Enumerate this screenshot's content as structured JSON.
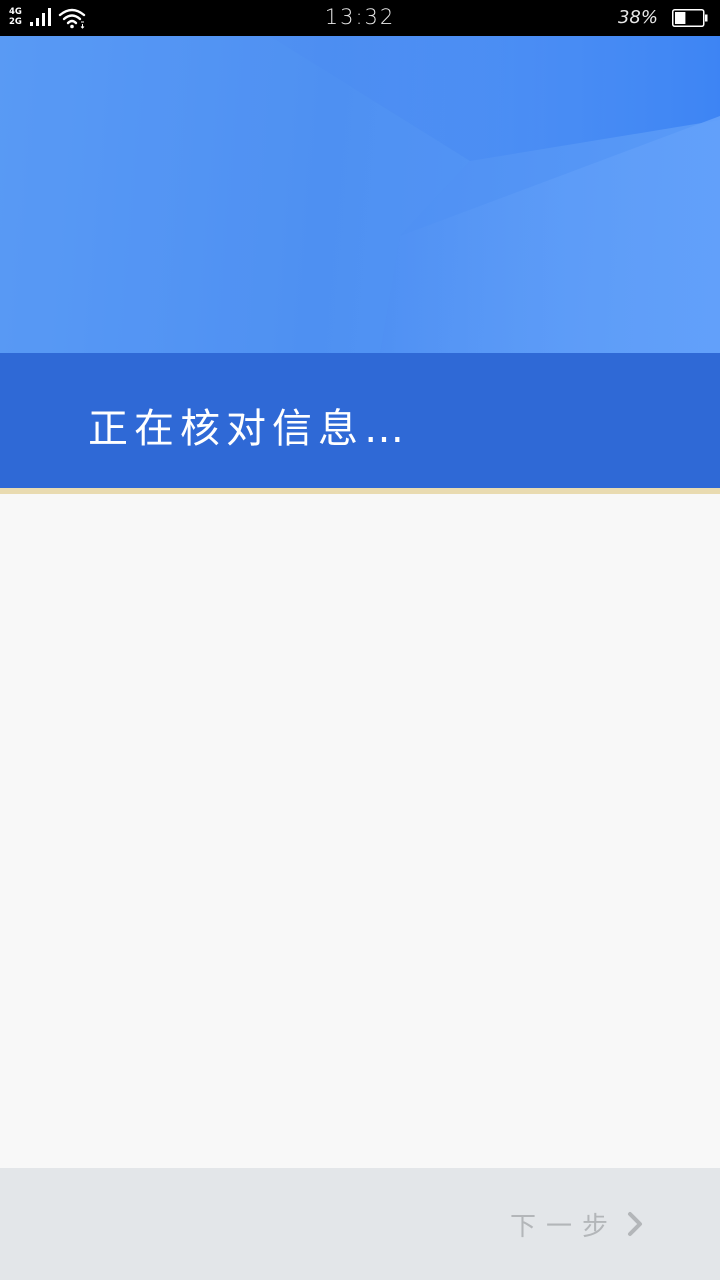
{
  "status_bar": {
    "network_top": "4G",
    "network_bottom": "2G",
    "signal_icon": "signal-bars-icon",
    "wifi_icon": "wifi-icon",
    "time": "13:32",
    "battery_percent": "38%",
    "battery_icon": "battery-icon",
    "battery_level": 0.38
  },
  "header": {
    "title": "正在核对信息…",
    "colors": {
      "hero": "#4d8ef2",
      "band": "#2f69d6",
      "accent_line": "#e9dbb1"
    }
  },
  "footer": {
    "next_label": "下一步",
    "next_icon": "chevron-right-icon",
    "text_color": "#b3b6b9",
    "background": "#e3e6e9"
  }
}
